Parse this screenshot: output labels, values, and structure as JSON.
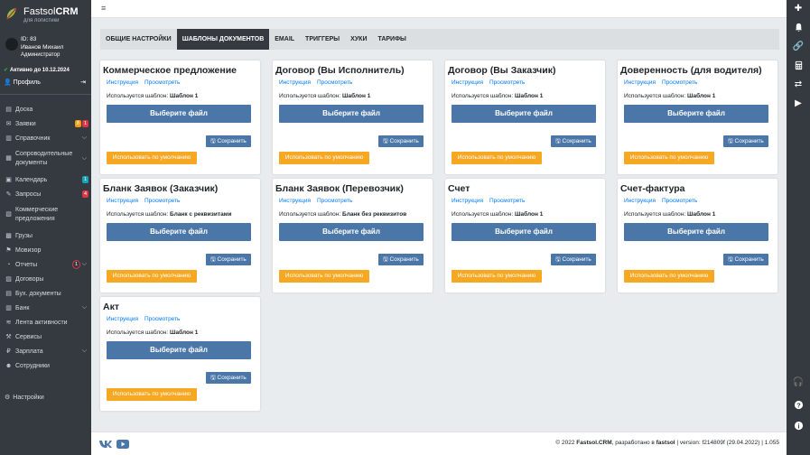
{
  "brand": {
    "name_light": "Fastsol",
    "name_bold": "CRM",
    "subtitle": "для логистики"
  },
  "user": {
    "id": "ID: 83",
    "name": "Иванов Михаил",
    "role": "Администратор"
  },
  "active_until": "Активно до 10.12.2024",
  "profile_label": "Профиль",
  "menu": [
    {
      "label": "Доска",
      "icon": "board-icon"
    },
    {
      "label": "Заявки",
      "icon": "orders-icon",
      "badges": [
        {
          "text": "8",
          "color": "#f39c12"
        },
        {
          "text": "1",
          "color": "#dc3545"
        }
      ]
    },
    {
      "label": "Справочник",
      "icon": "book-icon",
      "chevron": true
    },
    {
      "label": "Сопроводительные документы",
      "icon": "docs-icon",
      "chevron": true,
      "two": true
    },
    {
      "label": "Календарь",
      "icon": "calendar-icon",
      "badges": [
        {
          "text": "1",
          "color": "#17a2b8"
        }
      ]
    },
    {
      "label": "Запросы",
      "icon": "requests-icon",
      "badges": [
        {
          "text": "4",
          "color": "#dc3545"
        }
      ]
    },
    {
      "label": "Коммерческие предложения",
      "icon": "offers-icon",
      "two": true
    },
    {
      "label": "Грузы",
      "icon": "cargo-icon"
    },
    {
      "label": "Мовизор",
      "icon": "movizor-icon"
    },
    {
      "label": "Отчеты",
      "icon": "reports-icon",
      "chevron": true,
      "badges": [
        {
          "text": "1",
          "color": "#dc3545",
          "round": true
        }
      ]
    },
    {
      "label": "Договоры",
      "icon": "contracts-icon"
    },
    {
      "label": "Бух. документы",
      "icon": "accounting-icon"
    },
    {
      "label": "Банк",
      "icon": "bank-icon",
      "chevron": true
    },
    {
      "label": "Лента активности",
      "icon": "activity-icon"
    },
    {
      "label": "Сервисы",
      "icon": "services-icon"
    },
    {
      "label": "Зарплата",
      "icon": "salary-icon",
      "chevron": true
    },
    {
      "label": "Сотрудники",
      "icon": "employees-icon"
    }
  ],
  "settings_label": "Настройки",
  "tabs": [
    {
      "label": "ОБЩИЕ НАСТРОЙКИ",
      "active": false
    },
    {
      "label": "ШАБЛОНЫ ДОКУМЕНТОВ",
      "active": true
    },
    {
      "label": "EMAIL",
      "active": false
    },
    {
      "label": "ТРИГГЕРЫ",
      "active": false
    },
    {
      "label": "ХУКИ",
      "active": false
    },
    {
      "label": "ТАРИФЫ",
      "active": false
    }
  ],
  "card_labels": {
    "instruction": "Инструкция",
    "view": "Просмотреть",
    "used_prefix": "Используется шаблон:",
    "choose_file": "Выберите файл",
    "save": "Сохранить",
    "use_default": "Использовать по умолчанию"
  },
  "cards": [
    {
      "title": "Коммерческое предложение",
      "template": "Шаблон 1"
    },
    {
      "title": "Договор (Вы Исполнитель)",
      "template": "Шаблон 1"
    },
    {
      "title": "Договор (Вы Заказчик)",
      "template": "Шаблон 1"
    },
    {
      "title": "Доверенность (для водителя)",
      "template": "Шаблон 1"
    },
    {
      "title": "Бланк Заявок (Заказчик)",
      "template": "Бланк с реквизитами"
    },
    {
      "title": "Бланк Заявок (Перевозчик)",
      "template": "Бланк без реквизитов"
    },
    {
      "title": "Счет",
      "template": "Шаблон 1"
    },
    {
      "title": "Счет-фактура",
      "template": "Шаблон 1"
    },
    {
      "title": "Акт",
      "template": "Шаблон 1"
    }
  ],
  "footer": {
    "copyright": "© 2022",
    "product": "Fastsol.CRM",
    "developed_by": ", разработано в",
    "company": "fastsol",
    "version": " | version: f214809f (29.04.2022) | 1.055"
  },
  "colors": {
    "sidebar": "#343a40",
    "primary": "#4a76a8",
    "warning": "#f7a823",
    "link": "#007bff"
  }
}
